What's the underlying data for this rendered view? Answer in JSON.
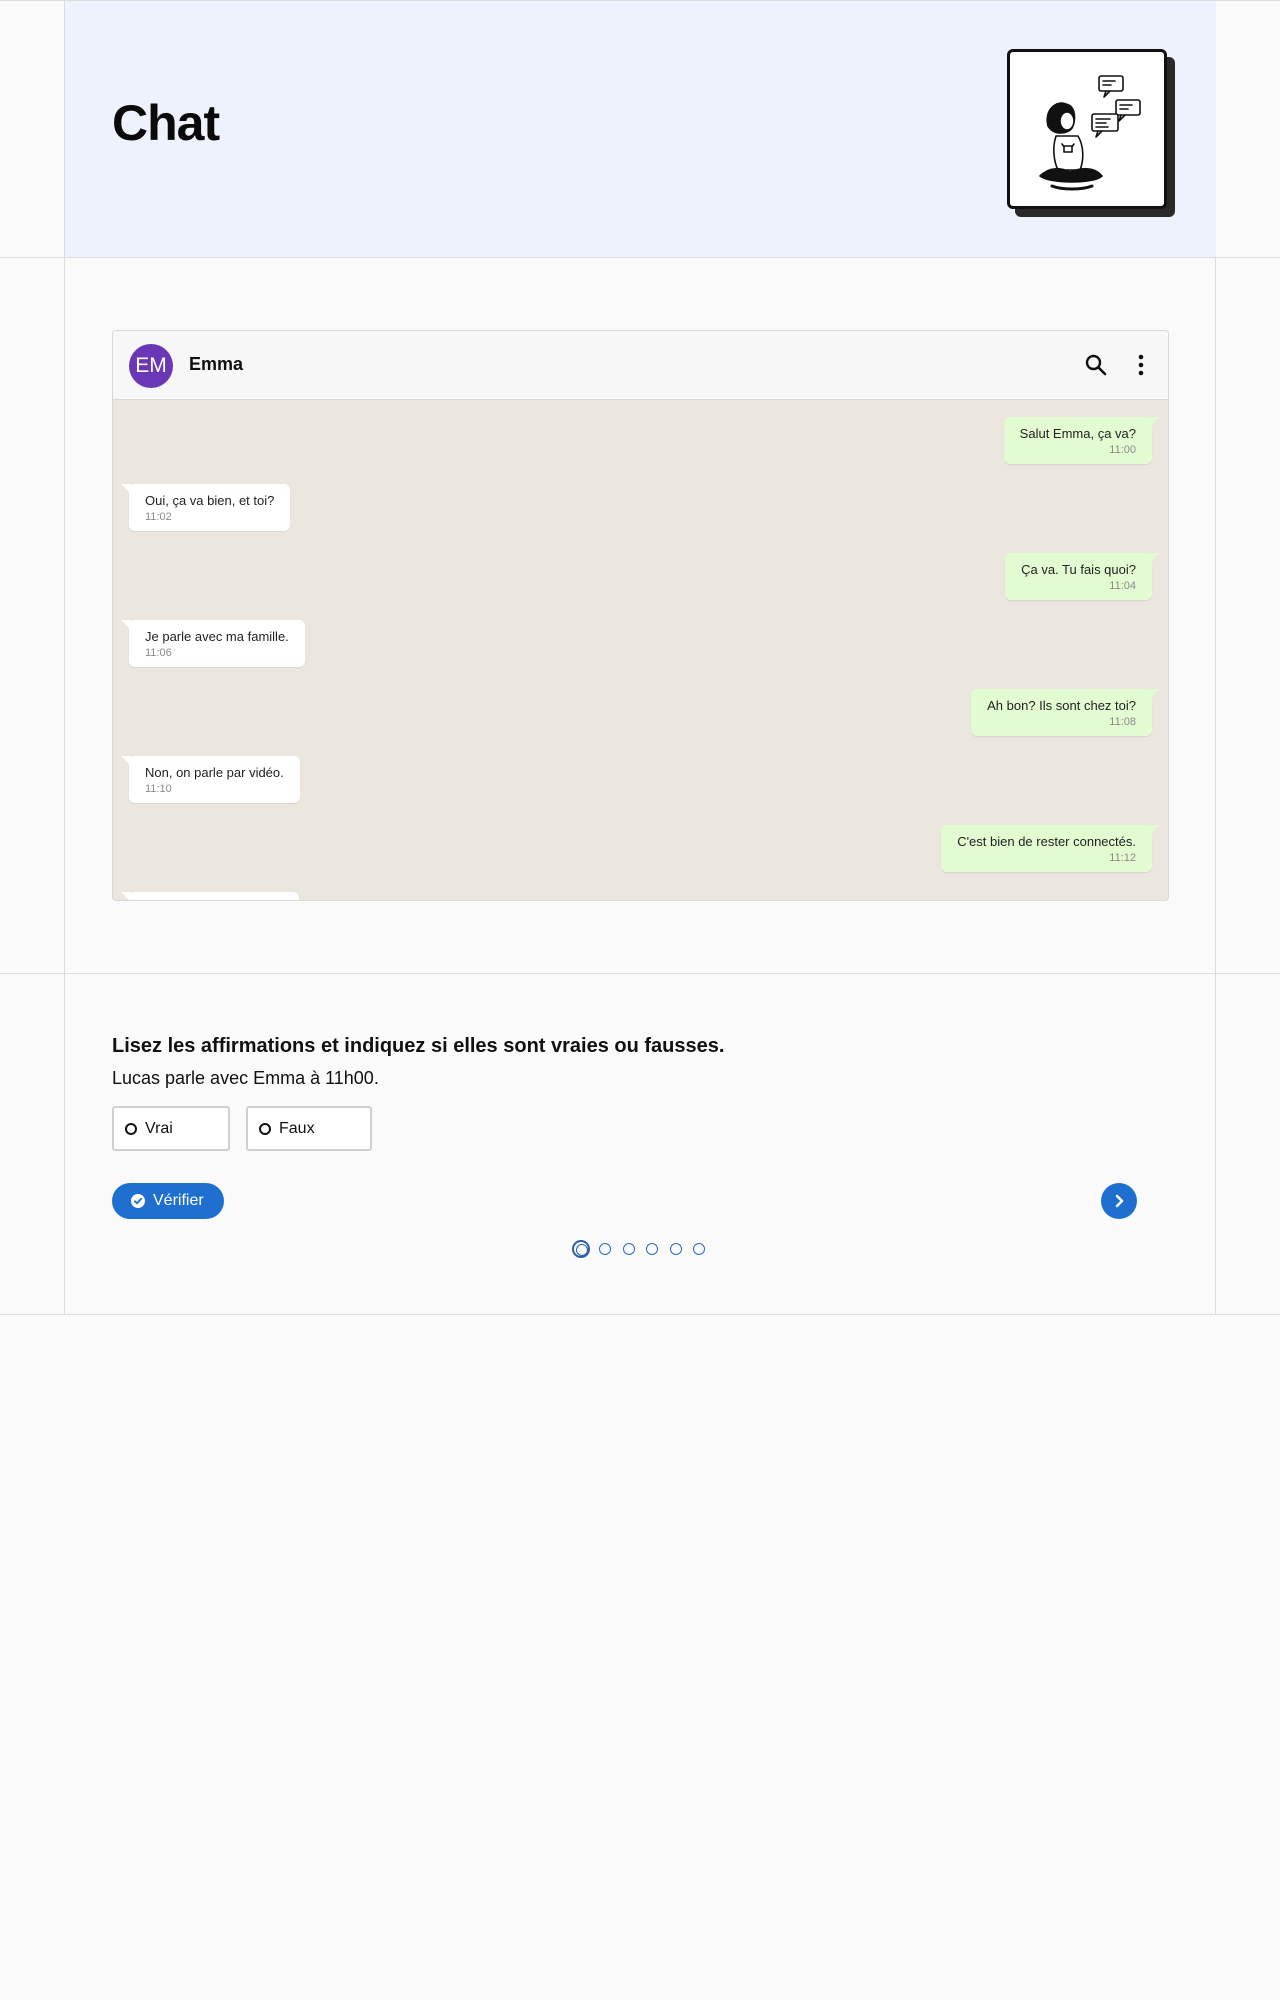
{
  "page": {
    "title": "Chat"
  },
  "chat": {
    "contact_initials": "EM",
    "contact_name": "Emma",
    "messages": [
      {
        "side": "out",
        "text": "Salut Emma, ça va?",
        "time": "11:00"
      },
      {
        "side": "in",
        "text": "Oui, ça va bien, et toi?",
        "time": "11:02"
      },
      {
        "side": "out",
        "text": "Ça va. Tu fais quoi?",
        "time": "11:04"
      },
      {
        "side": "in",
        "text": "Je parle avec ma famille.",
        "time": "11:06"
      },
      {
        "side": "out",
        "text": "Ah bon? Ils sont chez toi?",
        "time": "11:08"
      },
      {
        "side": "in",
        "text": "Non, on parle par vidéo.",
        "time": "11:10"
      },
      {
        "side": "out",
        "text": "C'est bien de rester connectés.",
        "time": "11:12"
      }
    ]
  },
  "exercise": {
    "instruction": "Lisez les affirmations et indiquez si elles sont vraies ou fausses.",
    "statement": "Lucas parle avec Emma à 11h00.",
    "options": [
      "Vrai",
      "Faux"
    ],
    "verify_label": "Vérifier",
    "progress": {
      "current": 1,
      "total": 6
    }
  },
  "colors": {
    "accent": "#1f6fd0",
    "avatar": "#6a38b6",
    "header_band": "#eef2fd",
    "outgoing_bubble": "#e3fbd1",
    "chat_background": "#ebe6de"
  }
}
